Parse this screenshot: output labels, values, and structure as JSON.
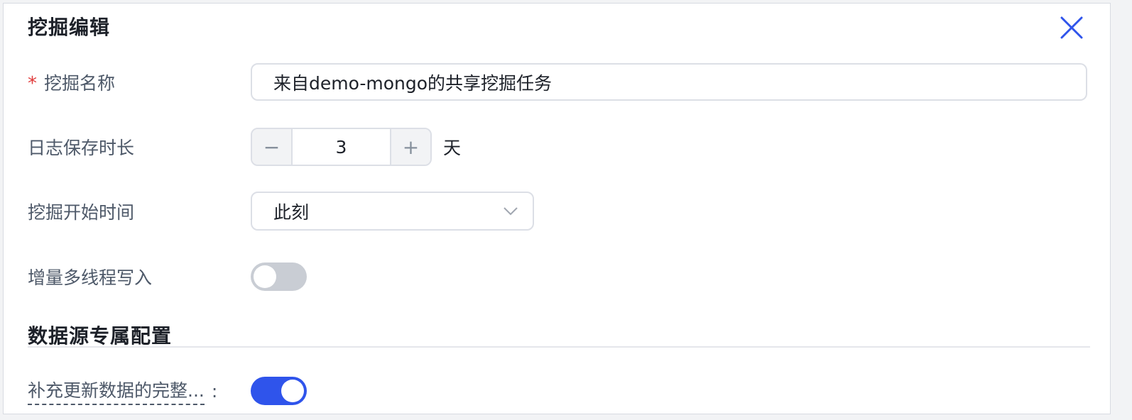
{
  "dialog": {
    "title": "挖掘编辑"
  },
  "form": {
    "name": {
      "required_mark": "*",
      "label": "挖掘名称",
      "value": "来自demo-mongo的共享挖掘任务"
    },
    "log_retention": {
      "label": "日志保存时长",
      "decrement": "−",
      "value": "3",
      "increment": "+",
      "unit": "天"
    },
    "start_time": {
      "label": "挖掘开始时间",
      "selected": "此刻"
    },
    "incremental_multithread": {
      "label": "增量多线程写入",
      "enabled": false
    }
  },
  "datasource_section": {
    "title": "数据源专属配置",
    "complete_update_data": {
      "label": "补充更新数据的完整...",
      "colon": ":",
      "enabled": true
    }
  },
  "colors": {
    "accent": "#2f54eb",
    "required": "#e03b3b",
    "toggle_off": "#c9cdd4"
  },
  "icons": {
    "close": "close-icon",
    "dropdown": "chevron-down-icon"
  }
}
